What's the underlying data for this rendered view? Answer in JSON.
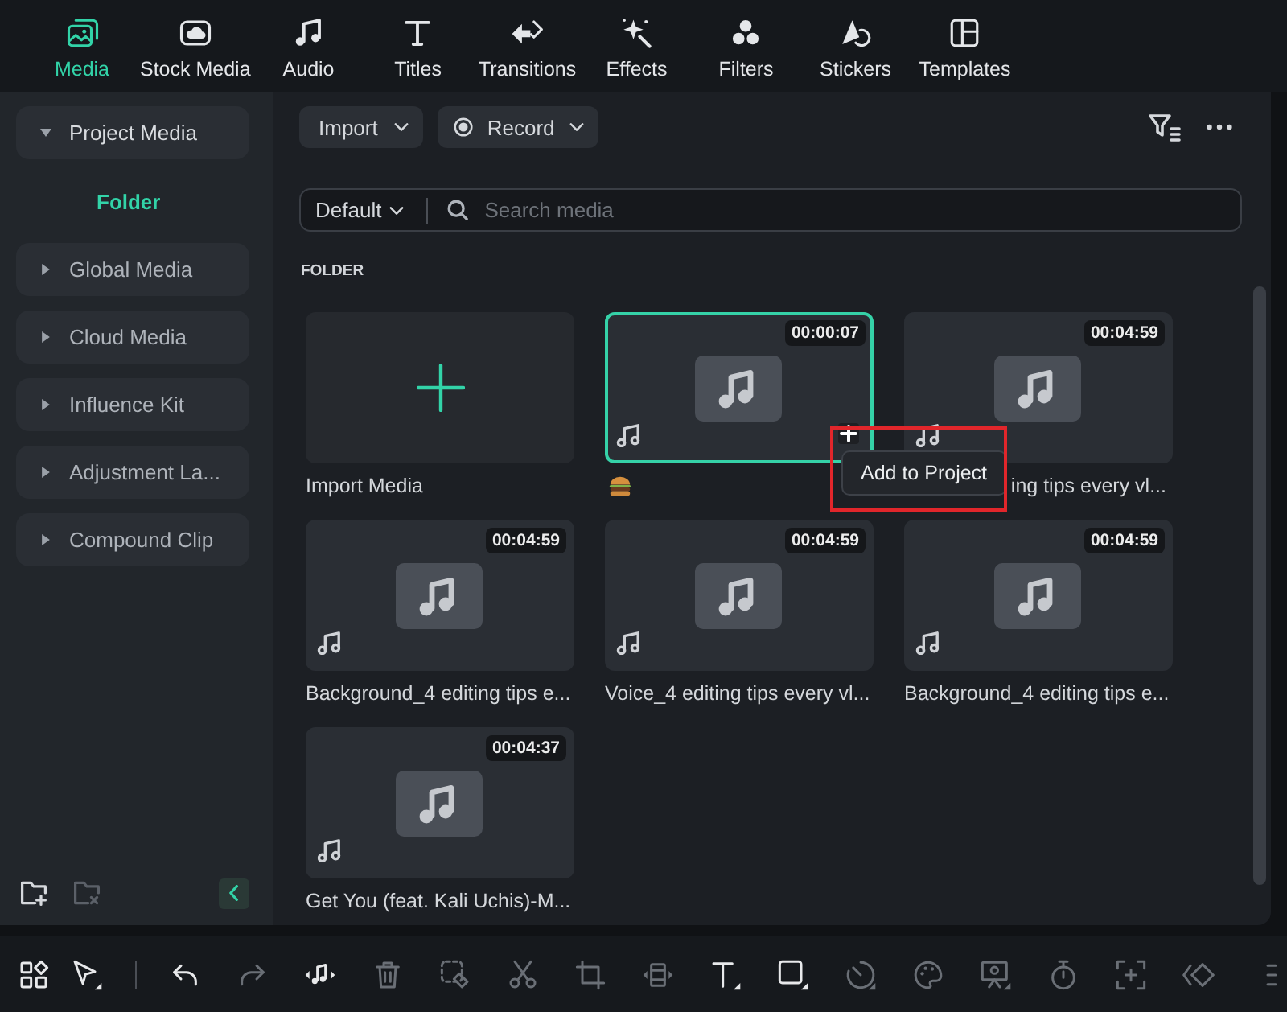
{
  "tabs": [
    {
      "label": "Media",
      "kind": "media",
      "selected": true
    },
    {
      "label": "Stock Media",
      "kind": "stock_media",
      "selected": false
    },
    {
      "label": "Audio",
      "kind": "audio",
      "selected": false
    },
    {
      "label": "Titles",
      "kind": "titles",
      "selected": false
    },
    {
      "label": "Transitions",
      "kind": "transitions",
      "selected": false
    },
    {
      "label": "Effects",
      "kind": "effects",
      "selected": false
    },
    {
      "label": "Filters",
      "kind": "filters",
      "selected": false
    },
    {
      "label": "Stickers",
      "kind": "stickers",
      "selected": false
    },
    {
      "label": "Templates",
      "kind": "templates",
      "selected": false
    }
  ],
  "sidebar": {
    "items": [
      {
        "label": "Project Media",
        "expanded": true,
        "selected": false,
        "children": [
          {
            "label": "Folder",
            "selected": true
          }
        ]
      },
      {
        "label": "Global Media",
        "expanded": false,
        "selected": false
      },
      {
        "label": "Cloud Media",
        "expanded": false,
        "selected": false
      },
      {
        "label": "Influence Kit",
        "expanded": false,
        "selected": false
      },
      {
        "label": "Adjustment La...",
        "expanded": false,
        "selected": false
      },
      {
        "label": "Compound Clip",
        "expanded": false,
        "selected": false
      }
    ],
    "footer": [
      {
        "kind": "new_folder",
        "disabled": false
      },
      {
        "kind": "delete_folder",
        "disabled": true
      },
      {
        "kind": "collapse",
        "disabled": false
      }
    ]
  },
  "toolbar": {
    "buttons": [
      {
        "kind": "import",
        "label": "Import"
      },
      {
        "kind": "record",
        "label": "Record"
      }
    ],
    "icons": [
      {
        "kind": "filter"
      },
      {
        "kind": "more"
      }
    ]
  },
  "search": {
    "sort": "Default",
    "placeholder": "Search media"
  },
  "media": {
    "section": "FOLDER",
    "items": [
      {
        "kind": "import",
        "name": "Import Media",
        "selected": false
      },
      {
        "kind": "audio",
        "duration": "00:00:07",
        "selected": true,
        "hovered": true,
        "name_covered": false
      },
      {
        "kind": "audio",
        "duration": "00:04:59",
        "name": "ing tips every vl...",
        "selected": false,
        "hovered": false,
        "name_covered": true
      },
      {
        "kind": "audio",
        "duration": "00:04:59",
        "name": "Background_4 editing tips e...",
        "selected": false,
        "hovered": false,
        "name_covered": false
      },
      {
        "kind": "audio",
        "duration": "00:04:59",
        "name": "Voice_4 editing tips every vl...",
        "selected": false,
        "hovered": false,
        "name_covered": false
      },
      {
        "kind": "audio",
        "duration": "00:04:59",
        "name": "Background_4 editing tips e...",
        "selected": false,
        "hovered": false,
        "name_covered": false
      },
      {
        "kind": "audio",
        "duration": "00:04:37",
        "name": "Get You (feat. Kali Uchis)-M...",
        "selected": false,
        "hovered": false,
        "name_covered": false
      }
    ],
    "tooltip": {
      "text": "Add to Project",
      "highlighted": true
    }
  },
  "tools": [
    {
      "kind": "layout",
      "disabled": false
    },
    {
      "kind": "select",
      "disabled": false
    },
    {
      "kind": "divider"
    },
    {
      "kind": "undo",
      "disabled": false
    },
    {
      "kind": "redo",
      "disabled": true
    },
    {
      "kind": "audio",
      "disabled": false
    },
    {
      "kind": "delete",
      "disabled": true
    },
    {
      "kind": "detach",
      "disabled": true
    },
    {
      "kind": "cut",
      "disabled": true
    },
    {
      "kind": "crop",
      "disabled": true
    },
    {
      "kind": "freeze",
      "disabled": true
    },
    {
      "kind": "text",
      "disabled": false
    },
    {
      "kind": "shape",
      "disabled": false
    },
    {
      "kind": "speed",
      "disabled": true
    },
    {
      "kind": "color",
      "disabled": true
    },
    {
      "kind": "presenter",
      "disabled": true
    },
    {
      "kind": "timer",
      "disabled": true
    },
    {
      "kind": "focus",
      "disabled": true
    },
    {
      "kind": "keyframe",
      "disabled": true
    },
    {
      "kind": "more_partial",
      "disabled": true
    }
  ]
}
